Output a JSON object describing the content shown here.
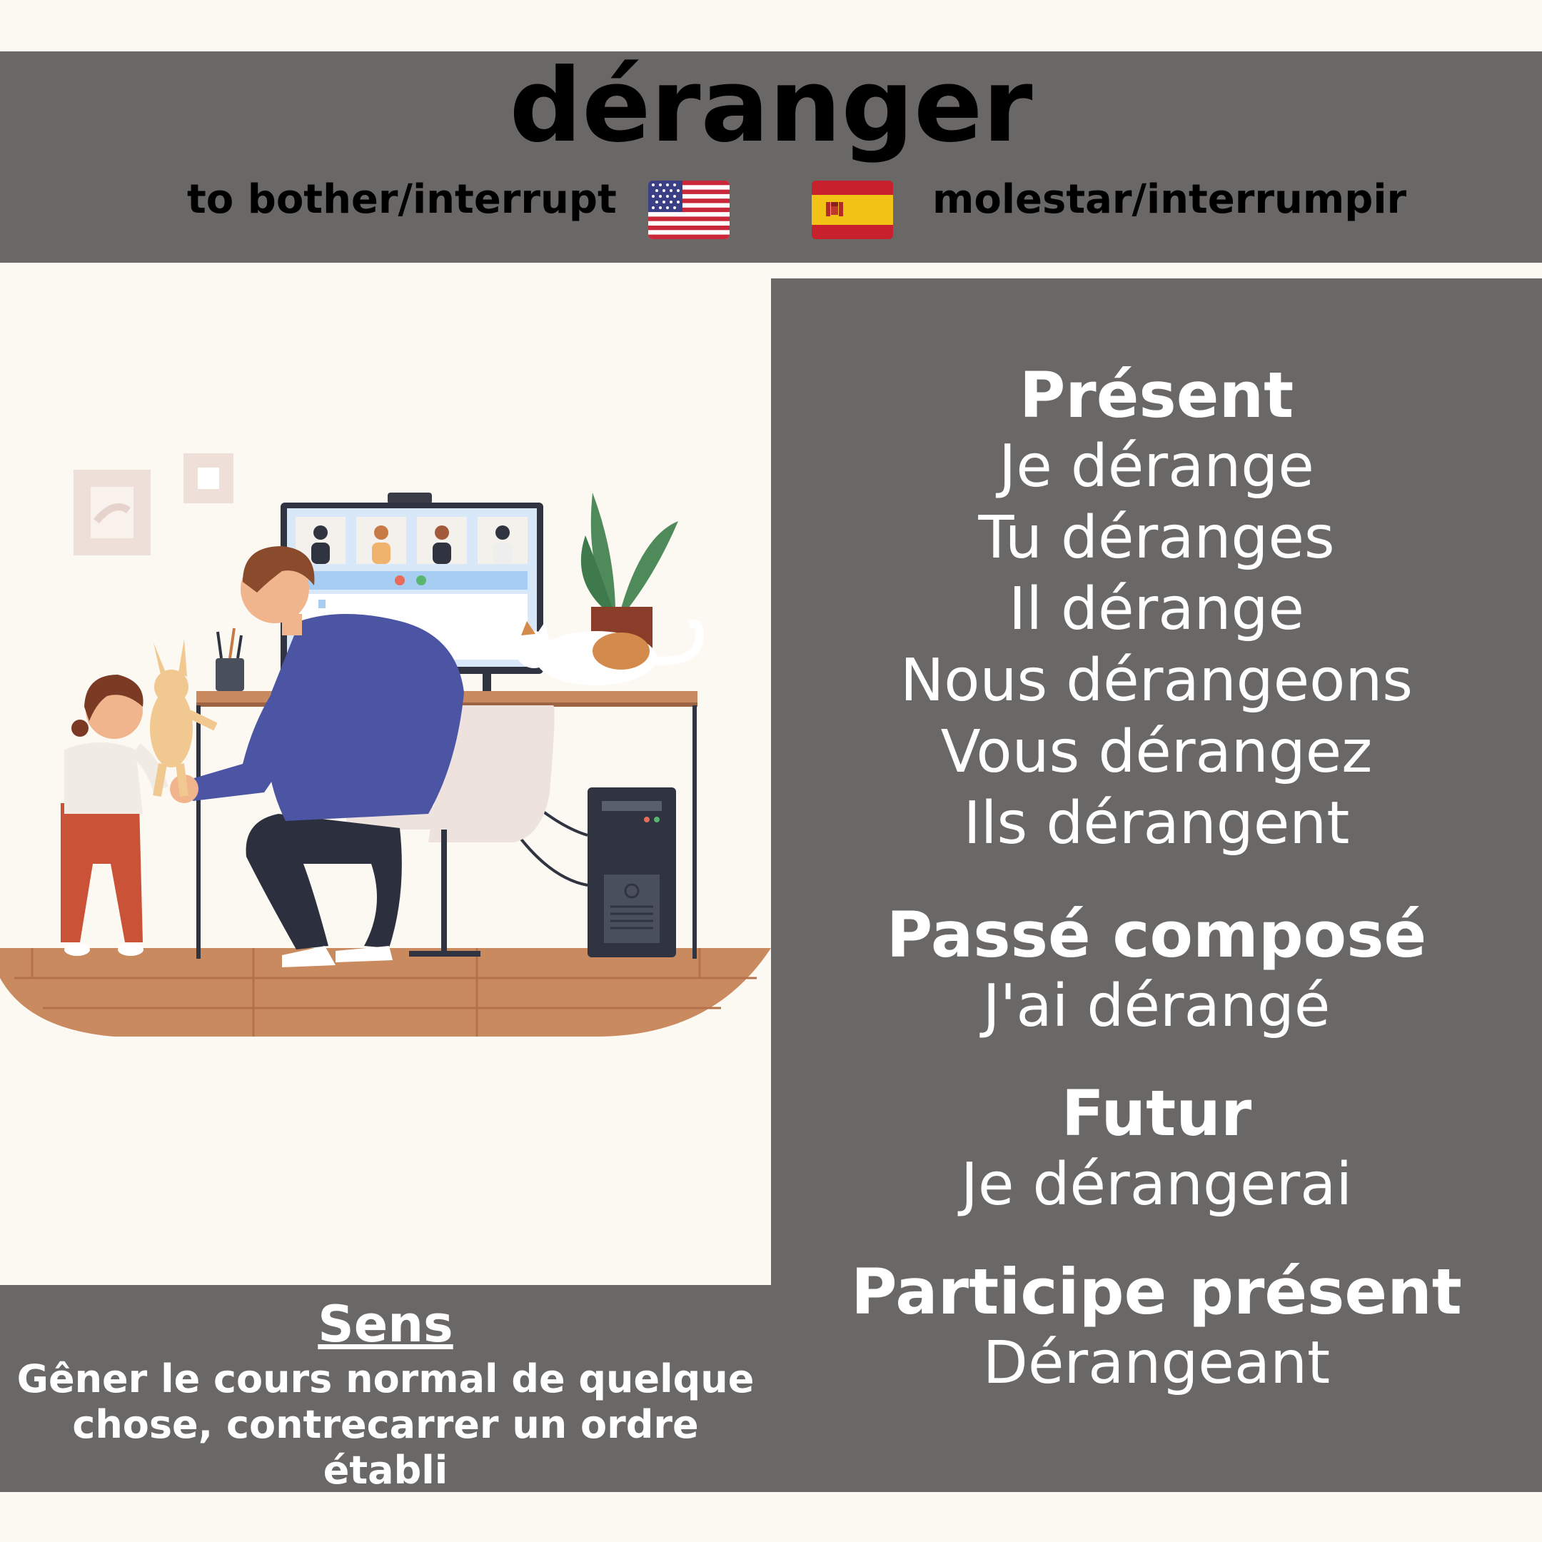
{
  "header": {
    "verb": "déranger",
    "english": "to bother/interrupt",
    "spanish": "molestar/interrumpir",
    "flag_left_icon": "us-flag-icon",
    "flag_right_icon": "spain-flag-icon"
  },
  "conjugations": {
    "present": {
      "title": "Présent",
      "forms": [
        "Je dérange",
        "Tu déranges",
        "Il dérange",
        "Nous dérangeons",
        "Vous dérangez",
        "Ils dérangent"
      ]
    },
    "passe_compose": {
      "title": "Passé composé",
      "form": "J'ai dérangé"
    },
    "futur": {
      "title": "Futur",
      "form": "Je dérangerai"
    },
    "participe_present": {
      "title": "Participe présent",
      "form": "Dérangeant"
    }
  },
  "meaning": {
    "title": "Sens",
    "text": "Gêner le cours normal de quelque chose, contrecarrer un ordre établi"
  },
  "colors": {
    "panel": "#6a6866",
    "background": "#fcf8f2",
    "text": "#ffffff",
    "floor": "#c98a5f"
  }
}
